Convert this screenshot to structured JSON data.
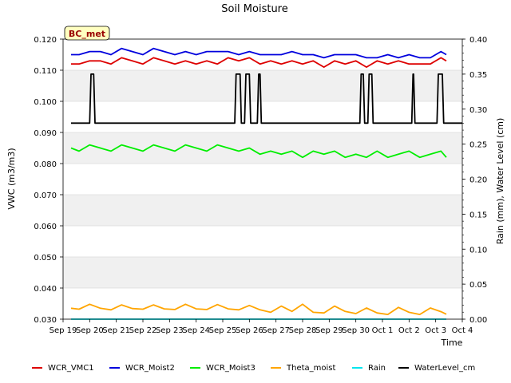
{
  "chart_data": {
    "type": "line",
    "title": "Soil Moisture",
    "xlabel": "Time",
    "ylabel_left": "VWC (m3/m3)",
    "ylabel_right": "Rain (mm), Water Level (cm)",
    "station_label": "BC_met",
    "x_range_days": [
      19,
      34
    ],
    "x_ticks": [
      {
        "x": 19,
        "label": "Sep 19"
      },
      {
        "x": 20,
        "label": "Sep 20"
      },
      {
        "x": 21,
        "label": "Sep 21"
      },
      {
        "x": 22,
        "label": "Sep 22"
      },
      {
        "x": 23,
        "label": "Sep 23"
      },
      {
        "x": 24,
        "label": "Sep 24"
      },
      {
        "x": 25,
        "label": "Sep 25"
      },
      {
        "x": 26,
        "label": "Sep 26"
      },
      {
        "x": 27,
        "label": "Sep 27"
      },
      {
        "x": 28,
        "label": "Sep 28"
      },
      {
        "x": 29,
        "label": "Sep 29"
      },
      {
        "x": 30,
        "label": "Sep 30"
      },
      {
        "x": 31,
        "label": "Oct 1"
      },
      {
        "x": 32,
        "label": "Oct 2"
      },
      {
        "x": 33,
        "label": "Oct 3"
      },
      {
        "x": 34,
        "label": "Oct 4"
      }
    ],
    "ylim_left": [
      0.03,
      0.12
    ],
    "yticks_left": [
      "0.030",
      "0.040",
      "0.050",
      "0.060",
      "0.070",
      "0.080",
      "0.090",
      "0.100",
      "0.110",
      "0.120"
    ],
    "ylim_right": [
      0.0,
      0.4
    ],
    "yticks_right": [
      "0.00",
      "0.05",
      "0.10",
      "0.15",
      "0.20",
      "0.25",
      "0.30",
      "0.35",
      "0.40"
    ],
    "grid": true,
    "legend_position": "bottom",
    "series": [
      {
        "name": "WCR_VMC1",
        "color": "#dd0000",
        "axis": "left",
        "x": [
          19.3,
          19.6,
          20.0,
          20.4,
          20.8,
          21.2,
          21.6,
          22.0,
          22.4,
          22.8,
          23.2,
          23.6,
          24.0,
          24.4,
          24.8,
          25.2,
          25.6,
          26.0,
          26.4,
          26.8,
          27.2,
          27.6,
          28.0,
          28.4,
          28.8,
          29.2,
          29.6,
          30.0,
          30.4,
          30.8,
          31.2,
          31.6,
          32.0,
          32.4,
          32.8,
          33.2,
          33.4
        ],
        "y": [
          0.112,
          0.112,
          0.113,
          0.113,
          0.112,
          0.114,
          0.113,
          0.112,
          0.114,
          0.113,
          0.112,
          0.113,
          0.112,
          0.113,
          0.112,
          0.114,
          0.113,
          0.114,
          0.112,
          0.113,
          0.112,
          0.113,
          0.112,
          0.113,
          0.111,
          0.113,
          0.112,
          0.113,
          0.111,
          0.113,
          0.112,
          0.113,
          0.112,
          0.112,
          0.112,
          0.114,
          0.113
        ]
      },
      {
        "name": "WCR_Moist2",
        "color": "#0000dd",
        "axis": "left",
        "x": [
          19.3,
          19.6,
          20.0,
          20.4,
          20.8,
          21.2,
          21.6,
          22.0,
          22.4,
          22.8,
          23.2,
          23.6,
          24.0,
          24.4,
          24.8,
          25.2,
          25.6,
          26.0,
          26.4,
          26.8,
          27.2,
          27.6,
          28.0,
          28.4,
          28.8,
          29.2,
          29.6,
          30.0,
          30.4,
          30.8,
          31.2,
          31.6,
          32.0,
          32.4,
          32.8,
          33.2,
          33.4
        ],
        "y": [
          0.115,
          0.115,
          0.116,
          0.116,
          0.115,
          0.117,
          0.116,
          0.115,
          0.117,
          0.116,
          0.115,
          0.116,
          0.115,
          0.116,
          0.116,
          0.116,
          0.115,
          0.116,
          0.115,
          0.115,
          0.115,
          0.116,
          0.115,
          0.115,
          0.114,
          0.115,
          0.115,
          0.115,
          0.114,
          0.114,
          0.115,
          0.114,
          0.115,
          0.114,
          0.114,
          0.116,
          0.115
        ]
      },
      {
        "name": "WCR_Moist3",
        "color": "#00ee00",
        "axis": "left",
        "x": [
          19.3,
          19.6,
          20.0,
          20.4,
          20.8,
          21.2,
          21.6,
          22.0,
          22.4,
          22.8,
          23.2,
          23.6,
          24.0,
          24.4,
          24.8,
          25.2,
          25.6,
          26.0,
          26.4,
          26.8,
          27.2,
          27.6,
          28.0,
          28.4,
          28.8,
          29.2,
          29.6,
          30.0,
          30.4,
          30.8,
          31.2,
          31.6,
          32.0,
          32.4,
          32.8,
          33.2,
          33.4
        ],
        "y": [
          0.085,
          0.084,
          0.086,
          0.085,
          0.084,
          0.086,
          0.085,
          0.084,
          0.086,
          0.085,
          0.084,
          0.086,
          0.085,
          0.084,
          0.086,
          0.085,
          0.084,
          0.085,
          0.083,
          0.084,
          0.083,
          0.084,
          0.082,
          0.084,
          0.083,
          0.084,
          0.082,
          0.083,
          0.082,
          0.084,
          0.082,
          0.083,
          0.084,
          0.082,
          0.083,
          0.084,
          0.082
        ]
      },
      {
        "name": "Theta_moist",
        "color": "#ffa500",
        "axis": "left",
        "x": [
          19.3,
          19.6,
          20.0,
          20.4,
          20.8,
          21.2,
          21.6,
          22.0,
          22.4,
          22.8,
          23.2,
          23.6,
          24.0,
          24.4,
          24.8,
          25.2,
          25.6,
          26.0,
          26.4,
          26.8,
          27.2,
          27.6,
          28.0,
          28.4,
          28.8,
          29.2,
          29.6,
          30.0,
          30.4,
          30.8,
          31.2,
          31.6,
          32.0,
          32.4,
          32.8,
          33.2,
          33.4
        ],
        "y": [
          0.0335,
          0.0332,
          0.0348,
          0.0335,
          0.033,
          0.0346,
          0.0334,
          0.0332,
          0.0346,
          0.0333,
          0.0331,
          0.0348,
          0.0333,
          0.0331,
          0.0347,
          0.0333,
          0.033,
          0.0344,
          0.033,
          0.0322,
          0.0342,
          0.0325,
          0.0348,
          0.0322,
          0.032,
          0.0342,
          0.0325,
          0.0318,
          0.0336,
          0.032,
          0.0315,
          0.0338,
          0.0322,
          0.0315,
          0.0336,
          0.0324,
          0.0316
        ]
      },
      {
        "name": "Rain",
        "color": "#00e5ee",
        "axis": "right",
        "x": [
          19.3,
          33.4
        ],
        "y": [
          0.0,
          0.0
        ]
      },
      {
        "name": "WaterLevel_cm",
        "color": "#000000",
        "axis": "right",
        "x": [
          19.3,
          20.0,
          20.05,
          20.15,
          20.2,
          25.45,
          25.5,
          25.65,
          25.7,
          25.82,
          25.87,
          26.0,
          26.05,
          26.3,
          26.35,
          26.4,
          26.45,
          30.15,
          30.2,
          30.28,
          30.33,
          30.45,
          30.5,
          30.6,
          30.65,
          32.1,
          32.15,
          32.17,
          32.22,
          33.05,
          33.1,
          33.25,
          33.3,
          34.4,
          34.45,
          34.7
        ],
        "y": [
          0.28,
          0.28,
          0.35,
          0.35,
          0.28,
          0.28,
          0.35,
          0.35,
          0.28,
          0.28,
          0.35,
          0.35,
          0.28,
          0.28,
          0.35,
          0.35,
          0.28,
          0.28,
          0.35,
          0.35,
          0.28,
          0.28,
          0.35,
          0.35,
          0.28,
          0.28,
          0.35,
          0.35,
          0.28,
          0.28,
          0.35,
          0.35,
          0.28,
          0.28,
          0.28,
          0.28
        ]
      }
    ]
  }
}
